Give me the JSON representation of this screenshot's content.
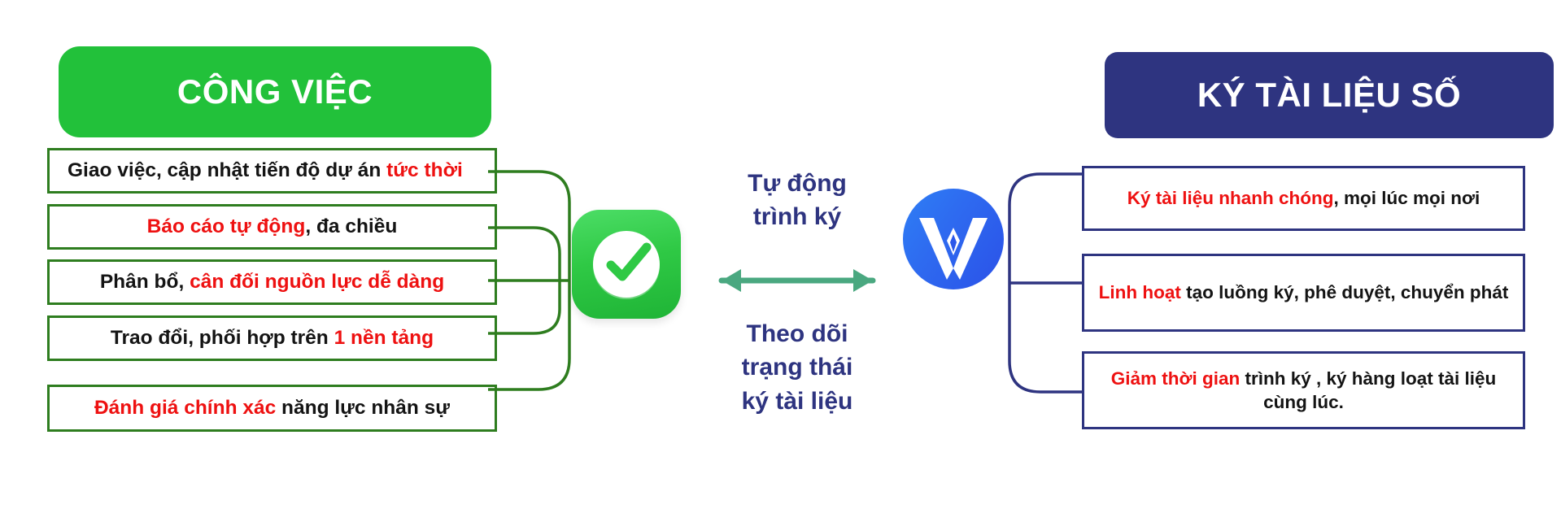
{
  "left_panel": {
    "header": "CÔNG VIỆC",
    "header_color": "#22C13A",
    "border_color": "#2E7D1F",
    "items": [
      {
        "plain_before": "Giao việc, cập nhật tiến độ  dự án ",
        "highlight": "tức thời",
        "plain_after": ""
      },
      {
        "plain_before": "",
        "highlight": "Báo cáo tự động",
        "plain_after": ", đa chiều"
      },
      {
        "plain_before": "Phân bổ, ",
        "highlight": "cân đối nguồn lực dễ dàng",
        "plain_after": ""
      },
      {
        "plain_before": "Trao đổi, phối hợp trên ",
        "highlight": "1 nền tảng",
        "plain_after": ""
      },
      {
        "plain_before": "",
        "highlight": "Đánh giá chính xác",
        "plain_after": " năng lực nhân sự"
      }
    ]
  },
  "right_panel": {
    "header": "KÝ TÀI LIỆU SỐ",
    "header_color": "#2E3480",
    "border_color": "#2E3480",
    "items": [
      {
        "plain_before": "",
        "highlight": "Ký tài liệu nhanh chóng",
        "plain_after": ", mọi lúc mọi nơi"
      },
      {
        "plain_before": "",
        "highlight": "Linh hoạt",
        "plain_after": " tạo luồng ký, phê duyệt, chuyển phát"
      },
      {
        "plain_before": "",
        "highlight": "Giảm thời gian",
        "plain_after": " trình ký , ký hàng loạt tài liệu cùng lúc."
      }
    ]
  },
  "center": {
    "label_top": "Tự động\ntrình ký",
    "label_bottom": "Theo dõi\ntrạng thái\nký tài liệu",
    "arrow_color": "#4AA880",
    "text_color": "#2E3480",
    "left_icon_name": "task-checkmark-icon",
    "right_icon_name": "wesign-logo-icon"
  },
  "colors": {
    "highlight_red": "#EE1111",
    "green": "#22C13A",
    "green_border": "#2E7D1F",
    "navy": "#2E3480",
    "arrow_green": "#4AA880",
    "blue_logo": "#2B58EA"
  }
}
